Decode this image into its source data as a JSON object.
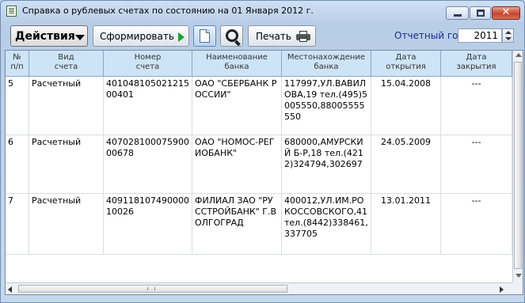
{
  "window": {
    "title": "Справка о рублевых счетах по состоянию на 01 Января 2012 г."
  },
  "toolbar": {
    "actions_label": "Действия",
    "form_label": "Сформировать",
    "print_label": "Печать",
    "year_label": "Отчетный год",
    "year_value": "2011"
  },
  "table": {
    "headers": [
      [
        "№",
        "п/п"
      ],
      [
        "Вид",
        "счета"
      ],
      [
        "Номер",
        "счета"
      ],
      [
        "Наименование",
        "банка"
      ],
      [
        "Местонахождение",
        "банка"
      ],
      [
        "Дата",
        "открытия"
      ],
      [
        "Дата",
        "закрытия"
      ]
    ],
    "rows": [
      {
        "num": "5",
        "type": "Расчетный",
        "account": "40104810502121500401",
        "bank": "ОАО \"СБЕРБАНК РОССИИ\"",
        "address": "117997,УЛ.ВАВИЛОВА,19 тел.(495)5005550,88005555550",
        "opened": "15.04.2008",
        "closed": "---"
      },
      {
        "num": "6",
        "type": "Расчетный",
        "account": "40702810007590000678",
        "bank": "ОАО \"НОМОС-РЕГИОБАНК\"",
        "address": "680000,АМУРСКИЙ Б-Р,18 тел.(4212)324794,302697",
        "opened": "24.05.2009",
        "closed": "---"
      },
      {
        "num": "7",
        "type": "Расчетный",
        "account": "40911810749000010026",
        "bank": "ФИЛИАЛ ЗАО \"РУССТРОЙБАНК\" Г.ВОЛГОГРАД",
        "address": "400012,УЛ.ИМ.РОКОССОВСКОГО,41 тел.(8442)338461,337705",
        "opened": "13.01.2011",
        "closed": "---"
      }
    ]
  }
}
